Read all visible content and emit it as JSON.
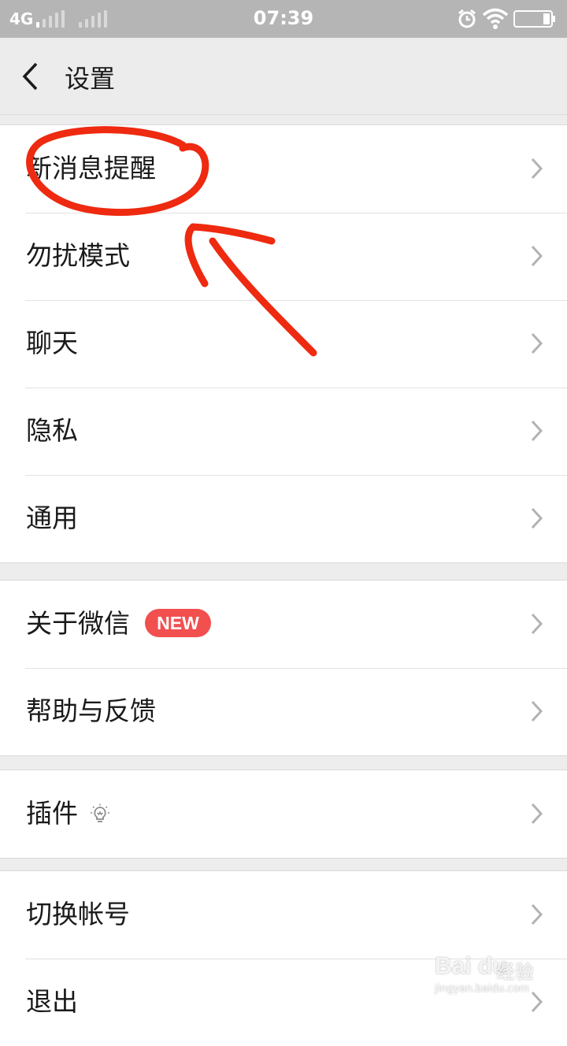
{
  "status_bar": {
    "network": "4G",
    "time": "07:39",
    "icons": [
      "signal-icon",
      "alarm-icon",
      "wifi-icon",
      "battery-icon"
    ]
  },
  "nav": {
    "title": "设置",
    "back_icon": "chevron-left-icon"
  },
  "groups": [
    {
      "items": [
        {
          "label": "新消息提醒"
        },
        {
          "label": "勿扰模式"
        },
        {
          "label": "聊天"
        },
        {
          "label": "隐私"
        },
        {
          "label": "通用"
        }
      ]
    },
    {
      "items": [
        {
          "label": "关于微信",
          "badge": "NEW"
        },
        {
          "label": "帮助与反馈"
        }
      ]
    },
    {
      "items": [
        {
          "label": "插件",
          "icon": "lightbulb-icon"
        }
      ]
    },
    {
      "items": [
        {
          "label": "切换帐号"
        },
        {
          "label": "退出"
        }
      ]
    }
  ],
  "watermark": {
    "logo": "Bai du",
    "text": "经验",
    "url": "jingyan.baidu.com"
  },
  "colors": {
    "status_bar": "#b5b5b5",
    "page_background": "#ededed",
    "badge": "#f24f4f",
    "annotation": "#ee2a10"
  }
}
